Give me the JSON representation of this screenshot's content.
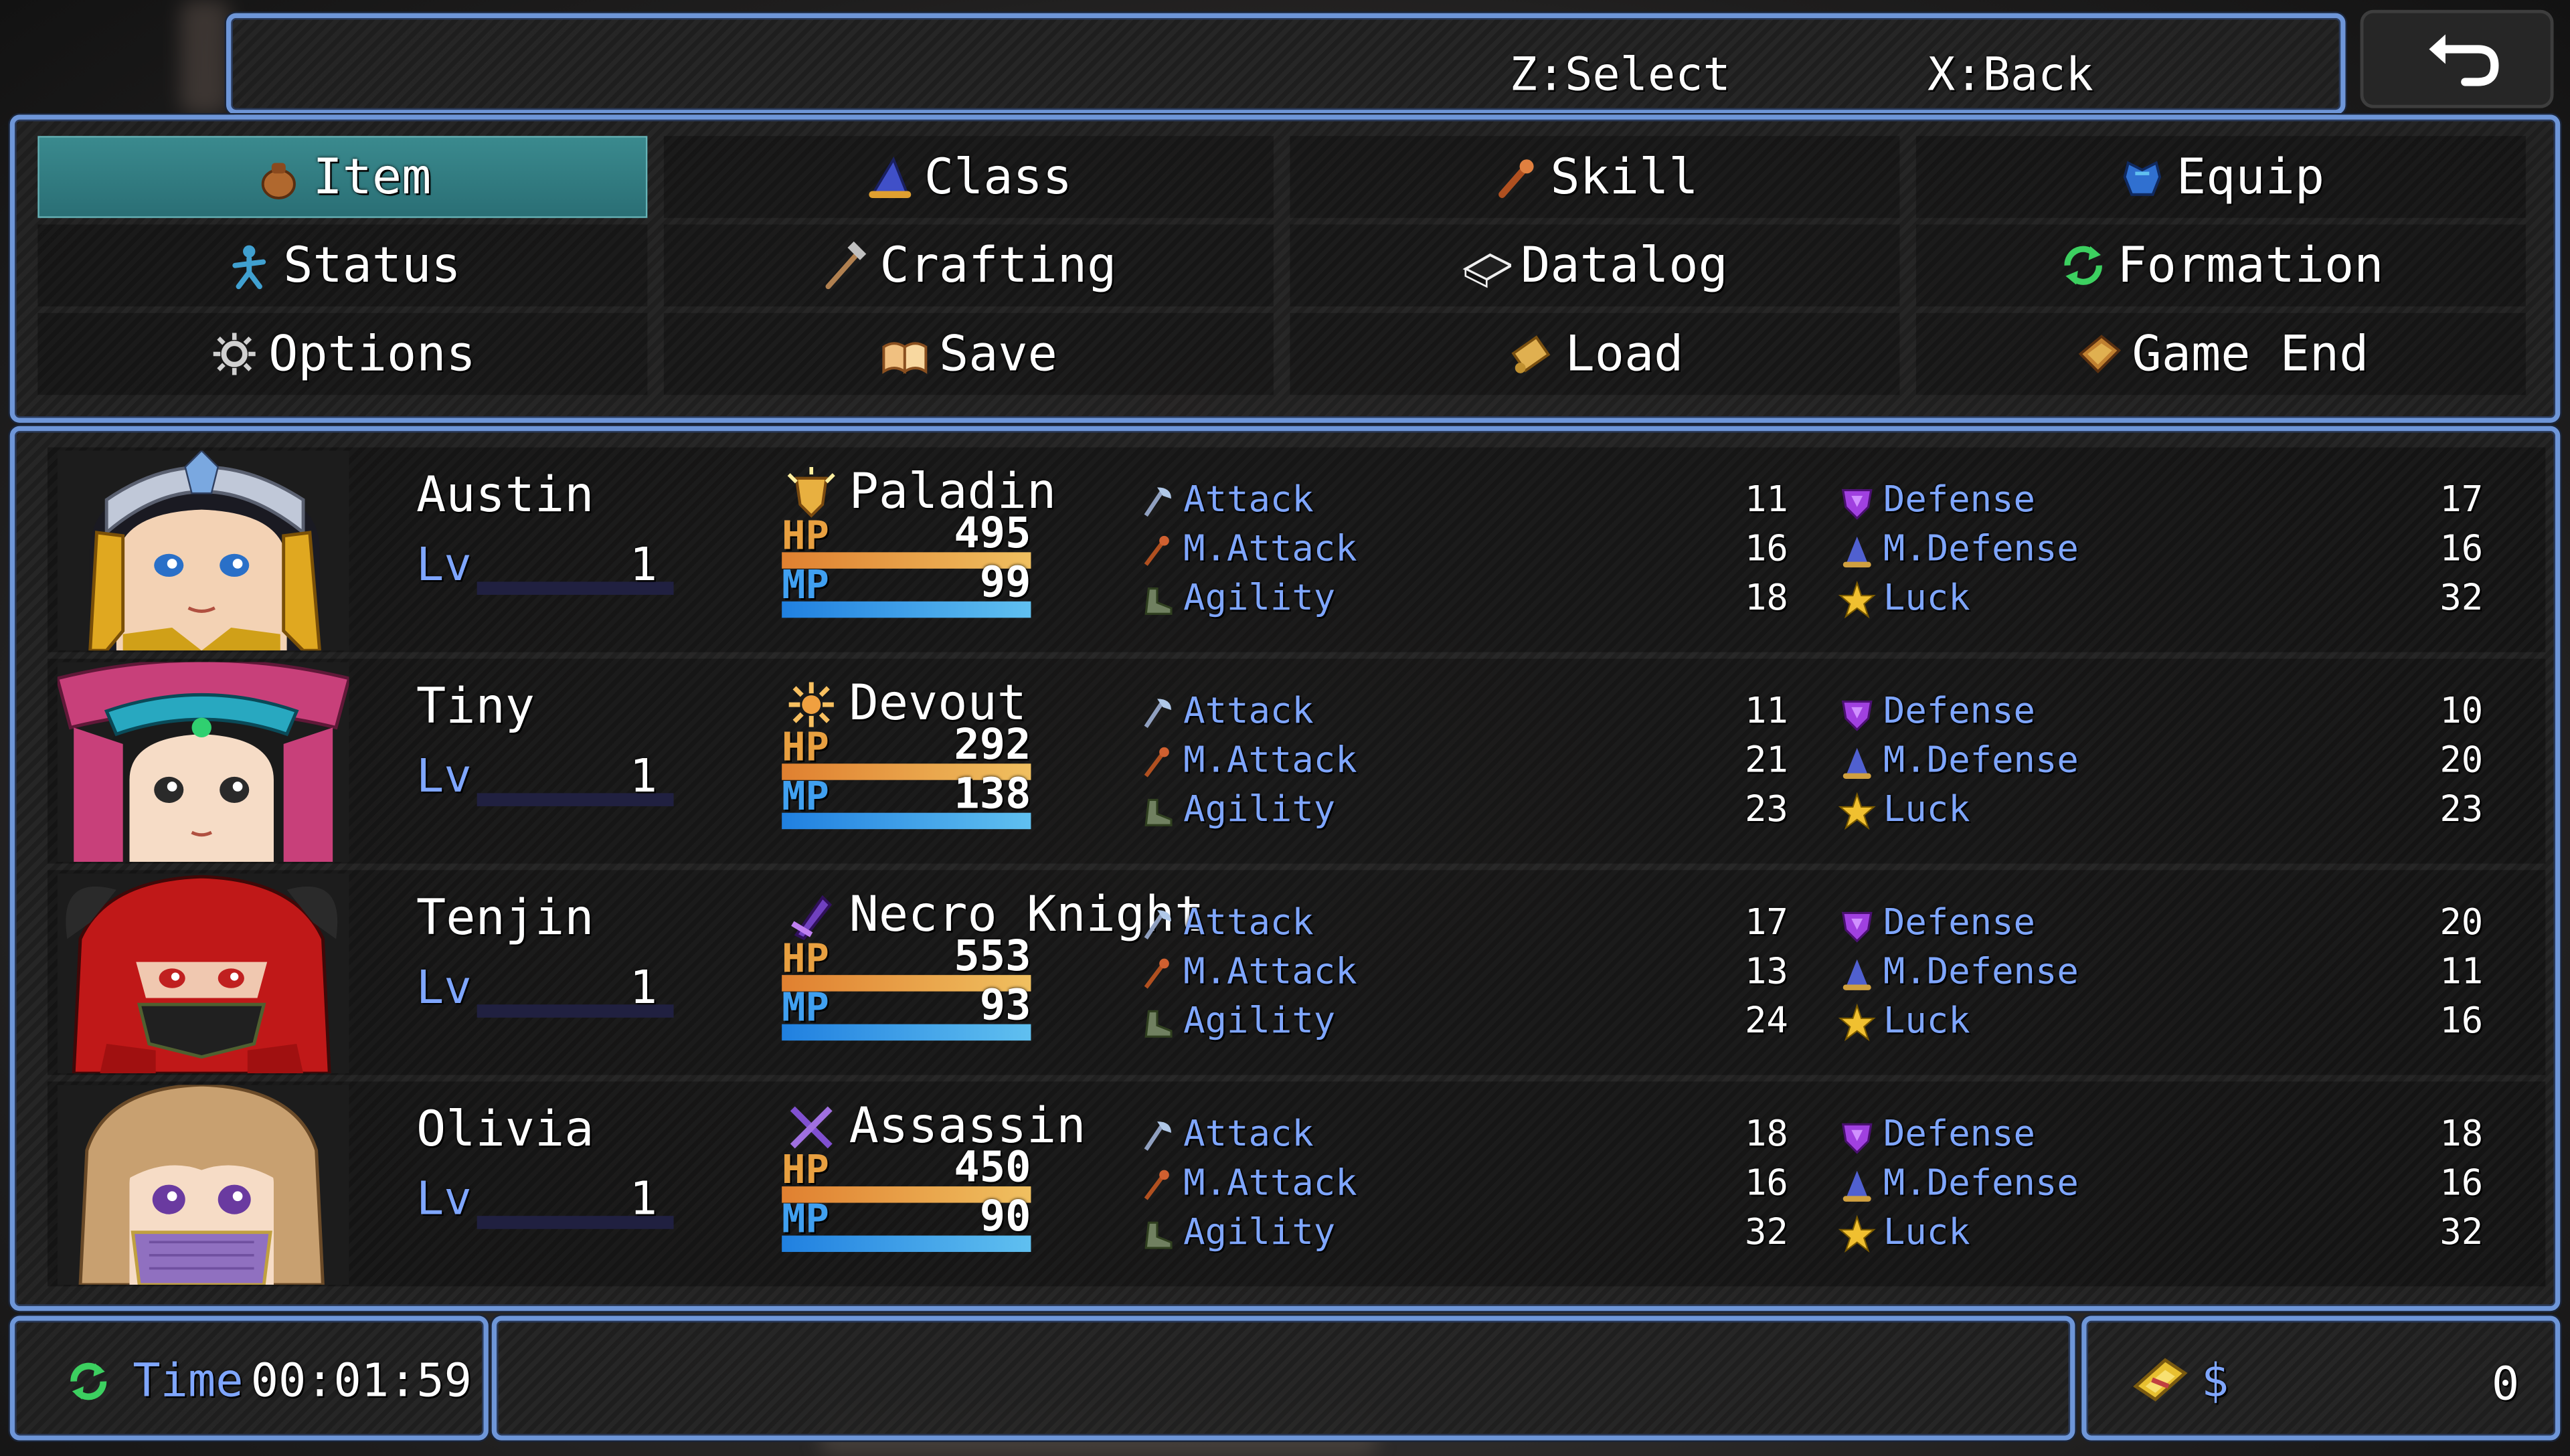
{
  "help": {
    "select_hint": "Z:Select",
    "back_hint": "X:Back"
  },
  "back_button_icon": "return-arrow-icon",
  "menu": {
    "commands": [
      {
        "label": "Item",
        "icon": "pouch-icon",
        "selected": true
      },
      {
        "label": "Class",
        "icon": "wizard-hat-icon",
        "selected": false
      },
      {
        "label": "Skill",
        "icon": "wand-icon",
        "selected": false
      },
      {
        "label": "Equip",
        "icon": "armor-icon",
        "selected": false
      },
      {
        "label": "Status",
        "icon": "figure-icon",
        "selected": false
      },
      {
        "label": "Crafting",
        "icon": "hammer-icon",
        "selected": false
      },
      {
        "label": "Datalog",
        "icon": "book-icon",
        "selected": false
      },
      {
        "label": "Formation",
        "icon": "cycle-icon",
        "selected": false
      },
      {
        "label": "Options",
        "icon": "gear-icon",
        "selected": false
      },
      {
        "label": "Save",
        "icon": "open-book-icon",
        "selected": false
      },
      {
        "label": "Load",
        "icon": "scroll-icon",
        "selected": false
      },
      {
        "label": "Game End",
        "icon": "door-icon",
        "selected": false
      }
    ]
  },
  "party": [
    {
      "name": "Austin",
      "level_label": "Lv",
      "level": "1",
      "class": "Paladin",
      "class_icon": "sun-shield-icon",
      "hp_label": "HP",
      "hp": "495",
      "hp_fill": 1.0,
      "mp_label": "MP",
      "mp": "99",
      "mp_fill": 1.0,
      "stats": {
        "attack": {
          "label": "Attack",
          "value": "11"
        },
        "m_attack": {
          "label": "M.Attack",
          "value": "16"
        },
        "agility": {
          "label": "Agility",
          "value": "18"
        },
        "defense": {
          "label": "Defense",
          "value": "17"
        },
        "m_defense": {
          "label": "M.Defense",
          "value": "16"
        },
        "luck": {
          "label": "Luck",
          "value": "32"
        }
      }
    },
    {
      "name": "Tiny",
      "level_label": "Lv",
      "level": "1",
      "class": "Devout",
      "class_icon": "sunburst-icon",
      "hp_label": "HP",
      "hp": "292",
      "hp_fill": 1.0,
      "mp_label": "MP",
      "mp": "138",
      "mp_fill": 1.0,
      "stats": {
        "attack": {
          "label": "Attack",
          "value": "11"
        },
        "m_attack": {
          "label": "M.Attack",
          "value": "21"
        },
        "agility": {
          "label": "Agility",
          "value": "23"
        },
        "defense": {
          "label": "Defense",
          "value": "10"
        },
        "m_defense": {
          "label": "M.Defense",
          "value": "20"
        },
        "luck": {
          "label": "Luck",
          "value": "23"
        }
      }
    },
    {
      "name": "Tenjin",
      "level_label": "Lv",
      "level": "1",
      "class": "Necro Knight",
      "class_icon": "dark-sword-icon",
      "hp_label": "HP",
      "hp": "553",
      "hp_fill": 1.0,
      "mp_label": "MP",
      "mp": "93",
      "mp_fill": 1.0,
      "stats": {
        "attack": {
          "label": "Attack",
          "value": "17"
        },
        "m_attack": {
          "label": "M.Attack",
          "value": "13"
        },
        "agility": {
          "label": "Agility",
          "value": "24"
        },
        "defense": {
          "label": "Defense",
          "value": "20"
        },
        "m_defense": {
          "label": "M.Defense",
          "value": "11"
        },
        "luck": {
          "label": "Luck",
          "value": "16"
        }
      }
    },
    {
      "name": "Olivia",
      "level_label": "Lv",
      "level": "1",
      "class": "Assassin",
      "class_icon": "crossed-daggers-icon",
      "hp_label": "HP",
      "hp": "450",
      "hp_fill": 1.0,
      "mp_label": "MP",
      "mp": "90",
      "mp_fill": 1.0,
      "stats": {
        "attack": {
          "label": "Attack",
          "value": "18"
        },
        "m_attack": {
          "label": "M.Attack",
          "value": "16"
        },
        "agility": {
          "label": "Agility",
          "value": "32"
        },
        "defense": {
          "label": "Defense",
          "value": "18"
        },
        "m_defense": {
          "label": "M.Defense",
          "value": "16"
        },
        "luck": {
          "label": "Luck",
          "value": "32"
        }
      }
    }
  ],
  "time": {
    "label": "Time",
    "value": "00:01:59",
    "icon": "cycle-icon"
  },
  "gold": {
    "currency": "$",
    "value": "0",
    "icon": "gold-bar-icon"
  },
  "colors": {
    "window_border": "#6e96d8",
    "system_text": "#7fa6ff",
    "hp_gauge": [
      "#e08030",
      "#f0c060"
    ],
    "mp_gauge": [
      "#2080e0",
      "#60c0f0"
    ],
    "selected_command": "#3a8a8e"
  }
}
